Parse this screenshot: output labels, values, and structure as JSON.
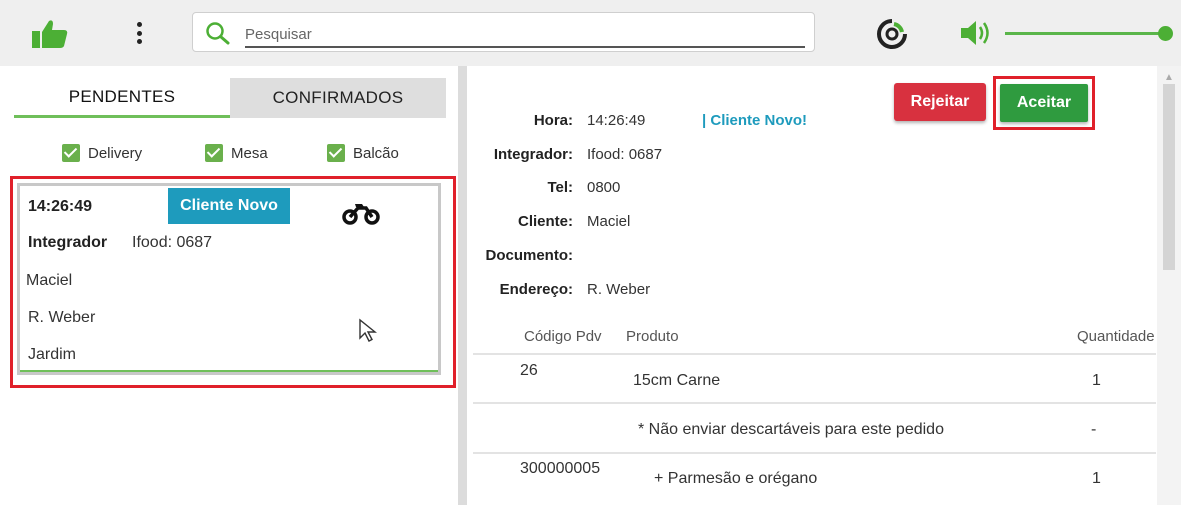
{
  "toolbar": {
    "like_icon": "thumbs-up-icon",
    "menu_icon": "vertical-dots-icon",
    "search_placeholder": "Pesquisar",
    "refresh_icon": "refresh-icon",
    "volume_icon": "speaker-icon",
    "volume_level": 1.0,
    "accent": "#4caf35"
  },
  "left": {
    "tabs": [
      {
        "label": "PENDENTES",
        "active": true
      },
      {
        "label": "CONFIRMADOS",
        "active": false
      }
    ],
    "filters": [
      {
        "label": "Delivery",
        "checked": true
      },
      {
        "label": "Mesa",
        "checked": true
      },
      {
        "label": "Balcão",
        "checked": true
      }
    ],
    "order": {
      "time": "14:26:49",
      "badge": "Cliente Novo",
      "integrator_label": "Integrador",
      "integrator_value": "Ifood: 0687",
      "customer": "Maciel",
      "street": "R. Weber",
      "district": "Jardim",
      "type_icon": "motorcycle-icon"
    }
  },
  "detail": {
    "reject_label": "Rejeitar",
    "accept_label": "Aceitar",
    "new_client_tag": "| Cliente Novo!",
    "fields": [
      {
        "label": "Hora:",
        "value": "14:26:49"
      },
      {
        "label": "Integrador:",
        "value": "Ifood: 0687"
      },
      {
        "label": "Tel:",
        "value": "0800"
      },
      {
        "label": "Cliente:",
        "value": "Maciel"
      },
      {
        "label": "Documento:",
        "value": ""
      },
      {
        "label": "Endereço:",
        "value": "R. Weber"
      }
    ],
    "table": {
      "headers": {
        "code": "Código Pdv",
        "product": "Produto",
        "qty": "Quantidade"
      },
      "rows": [
        {
          "code": "26",
          "product": "15cm Carne",
          "qty": "1"
        },
        {
          "code": "",
          "product": "* Não enviar descartáveis para este pedido",
          "qty": "-"
        },
        {
          "code": "300000005",
          "product": "+ Parmesão e orégano",
          "qty": "1"
        }
      ]
    }
  },
  "colors": {
    "green": "#2f9b3f",
    "red": "#d8313f",
    "teal": "#1e9bbd",
    "highlight": "#e0202a"
  }
}
